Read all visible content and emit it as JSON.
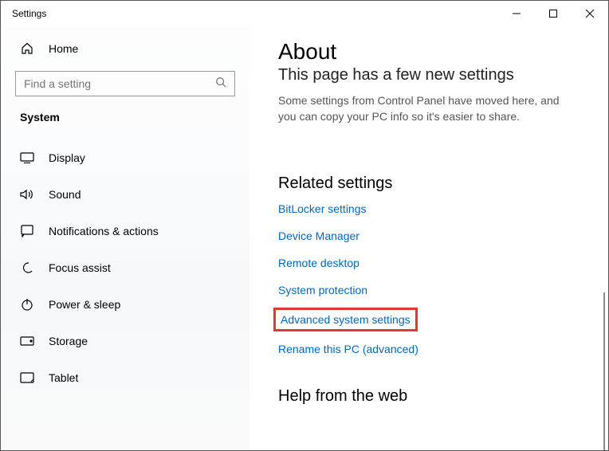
{
  "title_bar": {
    "title": "Settings"
  },
  "sidebar": {
    "home_label": "Home",
    "search_placeholder": "Find a setting",
    "category": "System",
    "items": [
      {
        "icon": "display",
        "label": "Display"
      },
      {
        "icon": "sound",
        "label": "Sound"
      },
      {
        "icon": "notifications",
        "label": "Notifications & actions"
      },
      {
        "icon": "focus",
        "label": "Focus assist"
      },
      {
        "icon": "power",
        "label": "Power & sleep"
      },
      {
        "icon": "storage",
        "label": "Storage"
      },
      {
        "icon": "tablet",
        "label": "Tablet"
      }
    ]
  },
  "main": {
    "title": "About",
    "subtitle": "This page has a few new settings",
    "description": "Some settings from Control Panel have moved here, and you can copy your PC info so it's easier to share.",
    "related_header": "Related settings",
    "links": {
      "bitlocker": "BitLocker settings",
      "device_manager": "Device Manager",
      "remote_desktop": "Remote desktop",
      "system_protection": "System protection",
      "advanced_system": "Advanced system settings",
      "rename_pc": "Rename this PC (advanced)"
    },
    "help_header": "Help from the web"
  }
}
